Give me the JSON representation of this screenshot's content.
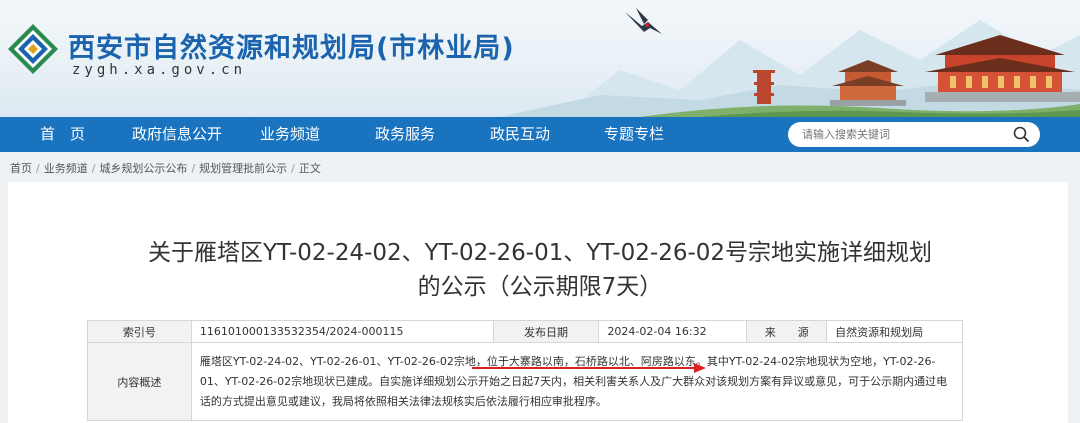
{
  "header": {
    "site_title": "西安市自然资源和规划局(市林业局)",
    "site_domain": "zygh.xa.gov.cn"
  },
  "nav": {
    "items": [
      {
        "label": "首　页"
      },
      {
        "label": "政府信息公开"
      },
      {
        "label": "业务频道"
      },
      {
        "label": "政务服务"
      },
      {
        "label": "政民互动"
      },
      {
        "label": "专题专栏"
      }
    ],
    "search_placeholder": "请输入搜索关键词"
  },
  "breadcrumb": {
    "items": [
      "首页",
      "业务频道",
      "城乡规划公示公布",
      "规划管理批前公示",
      "正文"
    ],
    "separator": "/"
  },
  "article": {
    "title_line1": "关于雁塔区YT-02-24-02、YT-02-26-01、YT-02-26-02号宗地实施详细规划",
    "title_line2": "的公示（公示期限7天）"
  },
  "info": {
    "index_label": "索引号",
    "index_value": "116101000133532354/2024-000115",
    "date_label": "发布日期",
    "date_value": "2024-02-04 16:32",
    "source_label": "来　　源",
    "source_value": "自然资源和规划局",
    "summary_label": "内容概述",
    "summary_value": "雁塔区YT-02-24-02、YT-02-26-01、YT-02-26-02宗地，位于大寨路以南，石桥路以北、阿房路以东。其中YT-02-24-02宗地现状为空地，YT-02-26-01、YT-02-26-02宗地现状已建成。自实施详细规划公示开始之日起7天内，相关利害关系人及广大群众对该规划方案有异议或意见，可于公示期内通过电话的方式提出意见或建议，我局将依照相关法律法规核实后依法履行相应审批程序。"
  },
  "colors": {
    "nav_bg": "#1a73bf",
    "title_blue": "#1b64ad",
    "annotation_red": "#e02020"
  }
}
